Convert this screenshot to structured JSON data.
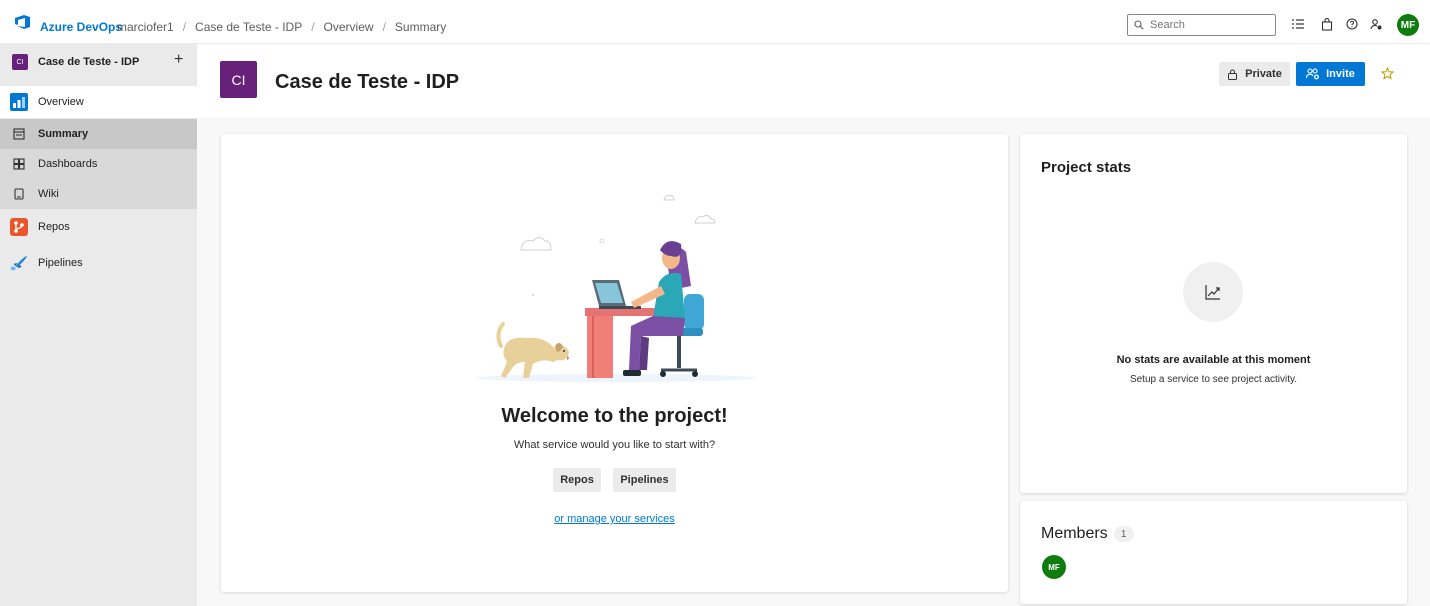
{
  "topbar": {
    "brand": "Azure DevOps",
    "breadcrumbs": [
      "marciofer1",
      "Case de Teste - IDP",
      "Overview",
      "Summary"
    ],
    "search_placeholder": "Search",
    "avatar_initials": "MF",
    "icons": [
      "task-list-icon",
      "shopping-bag-icon",
      "help-icon",
      "user-settings-icon"
    ]
  },
  "sidebar": {
    "project_badge": "CI",
    "project_name": "Case de Teste - IDP",
    "add_label": "+",
    "items": [
      {
        "label": "Overview",
        "icon": "overview-icon"
      },
      {
        "label": "Summary",
        "icon": "summary-icon"
      },
      {
        "label": "Dashboards",
        "icon": "dashboards-icon"
      },
      {
        "label": "Wiki",
        "icon": "wiki-icon"
      },
      {
        "label": "Repos",
        "icon": "repos-icon"
      },
      {
        "label": "Pipelines",
        "icon": "pipelines-icon"
      }
    ],
    "selected": "Summary"
  },
  "header": {
    "badge": "CI",
    "title": "Case de Teste - IDP",
    "private_label": "Private",
    "invite_label": "Invite"
  },
  "welcome": {
    "title": "Welcome to the project!",
    "subtitle": "What service would you like to start with?",
    "repos_button": "Repos",
    "pipelines_button": "Pipelines",
    "manage_link": "or manage your services"
  },
  "stats": {
    "title": "Project stats",
    "empty_title": "No stats are available at this moment",
    "empty_subtitle": "Setup a service to see project activity."
  },
  "members": {
    "title": "Members",
    "count": "1",
    "avatars": [
      "MF"
    ]
  },
  "colors": {
    "accent": "#0078d4",
    "project_badge": "#68217a",
    "avatar": "#107c10"
  }
}
